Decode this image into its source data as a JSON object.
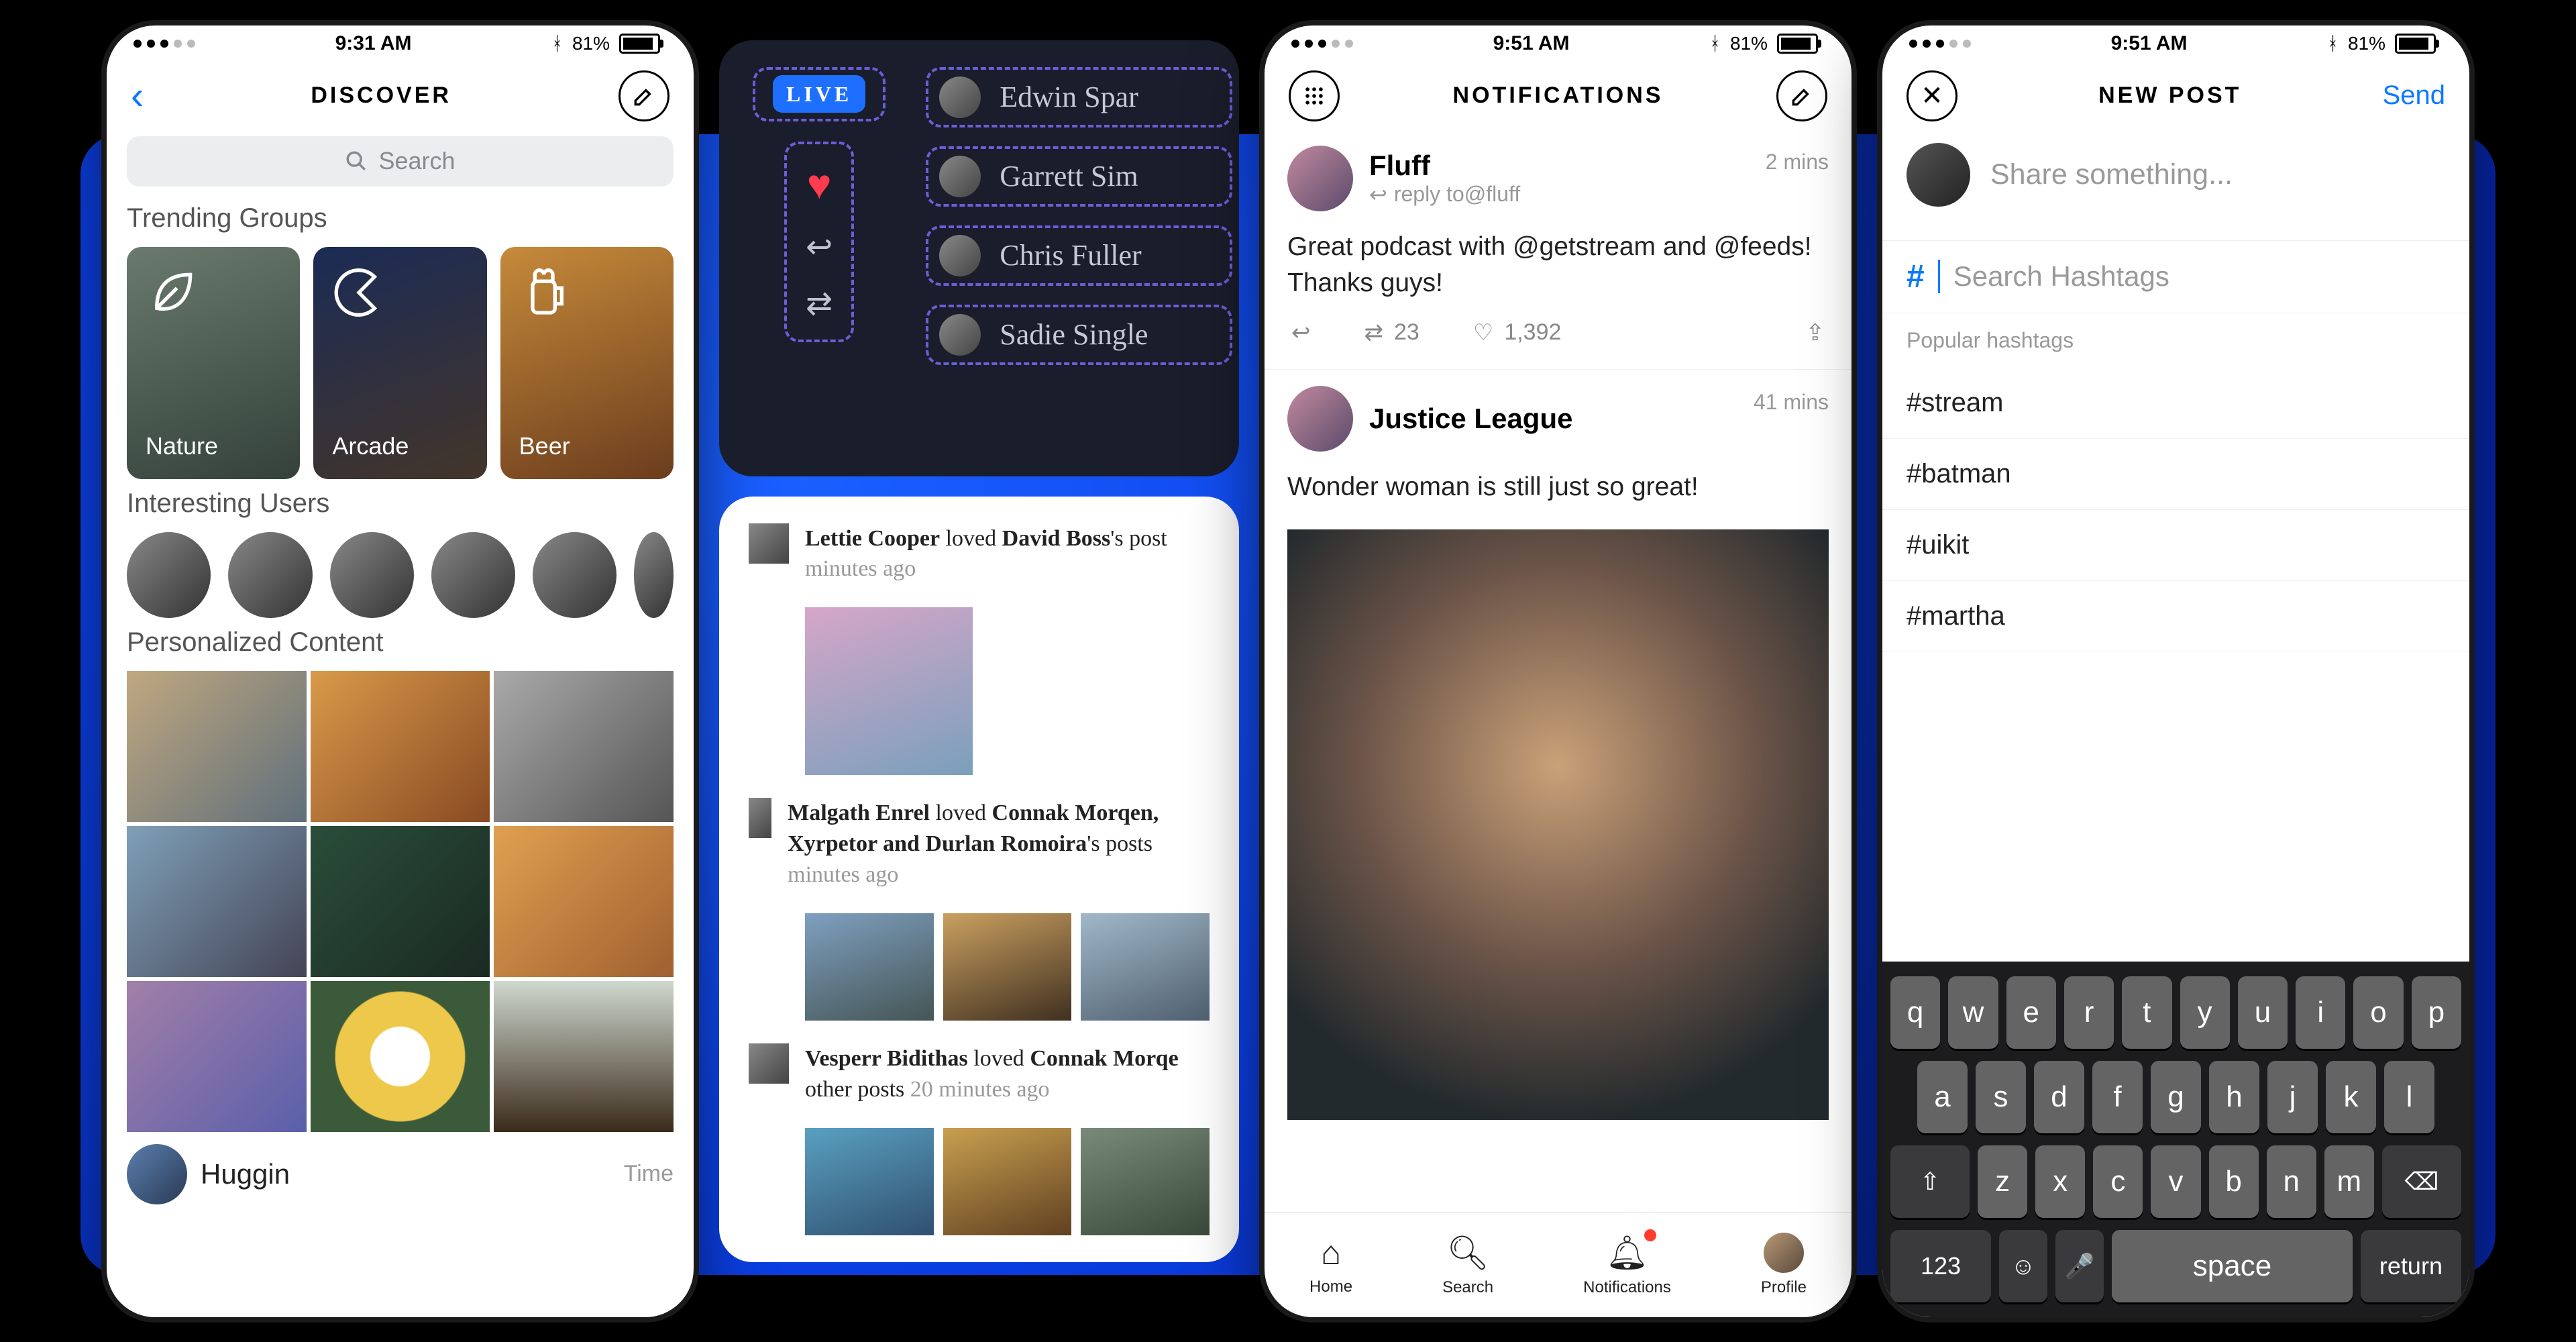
{
  "status": {
    "time1": "9:31 AM",
    "time2": "9:51 AM",
    "time3": "9:51 AM",
    "batt": "81%"
  },
  "discover": {
    "title": "DISCOVER",
    "search_placeholder": "Search",
    "sec_trending": "Trending Groups",
    "groups": [
      {
        "label": "Nature"
      },
      {
        "label": "Arcade"
      },
      {
        "label": "Beer"
      }
    ],
    "sec_users": "Interesting Users",
    "sec_personal": "Personalized Content",
    "footer_name": "Huggin",
    "footer_time": "Time"
  },
  "dark": {
    "live": "LIVE",
    "names": [
      "Edwin Spar",
      "Garrett Sim",
      "Chris Fuller",
      "Sadie Single"
    ]
  },
  "feed": {
    "rows": [
      {
        "actor": "Lettie Cooper",
        "verb": " loved ",
        "target": "David Boss",
        "suffix": "'s post",
        "ago": "minutes ago"
      },
      {
        "actor": "Malgath Enrel",
        "verb": " loved ",
        "target": "Connak Morqen, Xyrpetor and Durlan Romoira",
        "suffix": "'s posts",
        "ago": "minutes ago"
      },
      {
        "actor": "Vesperr Bidithas",
        "verb": " loved ",
        "target": "Connak Morqe",
        "suffix": "other posts ",
        "ago": "20 minutes ago"
      }
    ]
  },
  "notifications": {
    "title": "NOTIFICATIONS",
    "items": [
      {
        "name": "Fluff",
        "sub": "reply to@fluff",
        "when": "2 mins",
        "body": "Great podcast with @getstream and @feeds! Thanks guys!",
        "reposts": "23",
        "likes": "1,392"
      },
      {
        "name": "Justice League",
        "when": "41 mins",
        "body": "Wonder woman is still just so great!"
      }
    ],
    "tabs": [
      "Home",
      "Search",
      "Notifications",
      "Profile"
    ]
  },
  "newpost": {
    "title": "NEW POST",
    "send": "Send",
    "share_placeholder": "Share something...",
    "hashtag_placeholder": "Search Hashtags",
    "pop_header": "Popular hashtags",
    "hashtags": [
      "#stream",
      "#batman",
      "#uikit",
      "#martha"
    ]
  },
  "keyboard": {
    "r1": [
      "q",
      "w",
      "e",
      "r",
      "t",
      "y",
      "u",
      "i",
      "o",
      "p"
    ],
    "r2": [
      "a",
      "s",
      "d",
      "f",
      "g",
      "h",
      "j",
      "k",
      "l"
    ],
    "r3": [
      "z",
      "x",
      "c",
      "v",
      "b",
      "n",
      "m"
    ],
    "shift": "⇧",
    "del": "⌫",
    "num": "123",
    "emoji": "☺",
    "mic": "🎤",
    "space": "space",
    "return": "return"
  }
}
